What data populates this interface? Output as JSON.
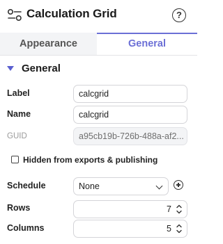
{
  "header": {
    "title": "Calculation Grid",
    "help_icon": "question-circle-icon",
    "logo_icon": "toggle-settings-icon",
    "help_glyph": "?"
  },
  "tabs": [
    {
      "label": "Appearance",
      "active": false
    },
    {
      "label": "General",
      "active": true
    }
  ],
  "section": {
    "label": "General",
    "expanded": true
  },
  "fields": {
    "label": {
      "label": "Label",
      "value": "calcgrid"
    },
    "name": {
      "label": "Name",
      "value": "calcgrid"
    },
    "guid": {
      "label": "GUID",
      "value": "a95cb19b-726b-488a-af2..."
    },
    "hidden": {
      "label": "Hidden from exports & publishing",
      "checked": false
    },
    "schedule": {
      "label": "Schedule",
      "value": "None"
    },
    "rows": {
      "label": "Rows",
      "value": "7"
    },
    "columns": {
      "label": "Columns",
      "value": "5"
    }
  },
  "colors": {
    "accent": "#6b6fd6",
    "tab_inactive_bg": "#f3f4f6",
    "border": "#d4d4d8"
  }
}
